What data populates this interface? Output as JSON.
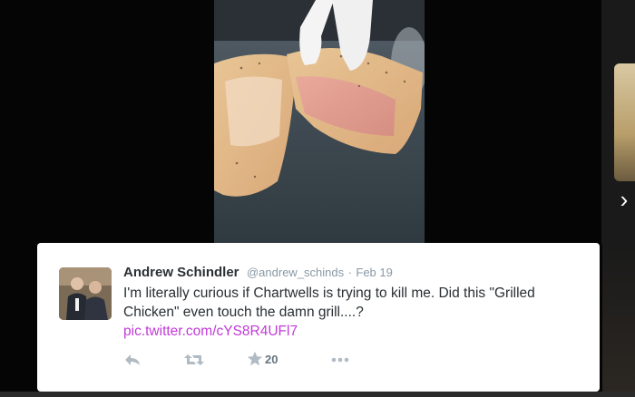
{
  "tweet": {
    "display_name": "Andrew Schindler",
    "handle": "@andrew_schinds",
    "separator": "·",
    "date": "Feb 19",
    "text": "I'm literally curious if Chartwells is trying to kill me. Did this \"Grilled Chicken\" even touch the damn grill....?",
    "link": "pic.twitter.com/cYS8R4UFl7",
    "favorite_count": "20",
    "link_color": "#c13ad8"
  },
  "icons": {
    "reply": "reply-icon",
    "retweet": "retweet-icon",
    "favorite": "star-icon",
    "more": "more-icon",
    "next": "chevron-right-icon"
  }
}
